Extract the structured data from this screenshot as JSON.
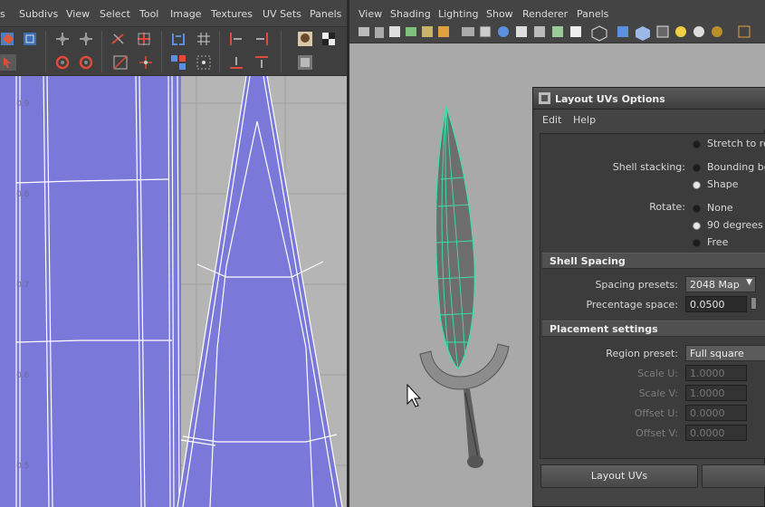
{
  "uv_editor": {
    "menus": [
      "s",
      "Subdivs",
      "View",
      "Select",
      "Tool",
      "Image",
      "Textures",
      "UV Sets",
      "Panels"
    ],
    "grid_labels": [
      "0.9",
      "0.8",
      "0.7",
      "0.6",
      "0.5"
    ],
    "uv_fill_color": "#7a78d8"
  },
  "viewport": {
    "menus": [
      "View",
      "Shading",
      "Lighting",
      "Show",
      "Renderer",
      "Panels"
    ],
    "background_color": "#a9a9a9",
    "wireframe_color": "#3fe0a8"
  },
  "dialog": {
    "title": "Layout UVs Options",
    "menus": [
      "Edit",
      "Help"
    ],
    "stretch_option": "Stretch to reg",
    "shell_stacking": {
      "label": "Shell stacking:",
      "options": [
        "Bounding box",
        "Shape"
      ],
      "selected": "Shape"
    },
    "rotate": {
      "label": "Rotate:",
      "options": [
        "None",
        "90 degrees",
        "Free"
      ],
      "selected": "90 degrees"
    },
    "shell_spacing": {
      "header": "Shell Spacing",
      "spacing_presets_label": "Spacing presets:",
      "spacing_presets_value": "2048 Map",
      "percentage_space_label": "Precentage space:",
      "percentage_space_value": "0.0500"
    },
    "placement": {
      "header": "Placement settings",
      "region_preset_label": "Region preset:",
      "region_preset_value": "Full square",
      "scale_u_label": "Scale U:",
      "scale_u_value": "1.0000",
      "scale_v_label": "Scale V:",
      "scale_v_value": "1.0000",
      "offset_u_label": "Offset U:",
      "offset_u_value": "0.0000",
      "offset_v_label": "Offset V:",
      "offset_v_value": "0.0000"
    },
    "buttons": {
      "layout": "Layout UVs",
      "second": ""
    }
  }
}
